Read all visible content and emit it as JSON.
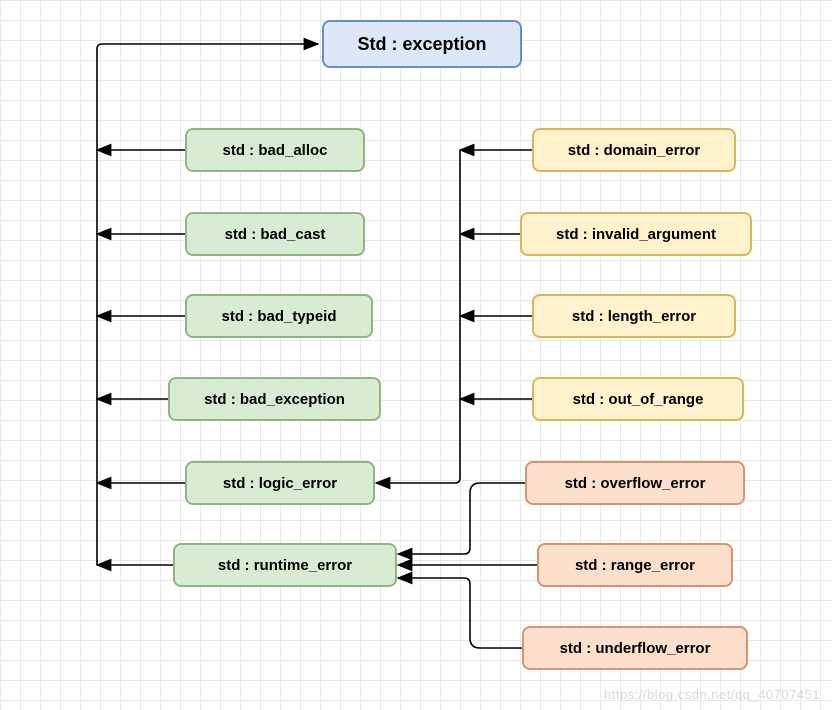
{
  "root": {
    "label": "Std : exception"
  },
  "green": [
    {
      "label": "std : bad_alloc"
    },
    {
      "label": "std : bad_cast"
    },
    {
      "label": "std : bad_typeid"
    },
    {
      "label": "std : bad_exception"
    },
    {
      "label": "std : logic_error"
    },
    {
      "label": "std : runtime_error"
    }
  ],
  "yellow": [
    {
      "label": "std : domain_error"
    },
    {
      "label": "std : invalid_argument"
    },
    {
      "label": "std : length_error"
    },
    {
      "label": "std : out_of_range"
    }
  ],
  "orange": [
    {
      "label": "std : overflow_error"
    },
    {
      "label": "std : range_error"
    },
    {
      "label": "std : underflow_error"
    }
  ],
  "watermark": "https://blog.csdn.net/qq_40707451"
}
